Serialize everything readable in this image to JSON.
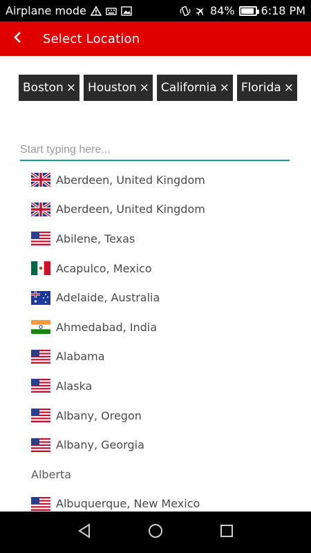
{
  "status_bar": {
    "left_text": "Airplane mode",
    "battery_percent": "84%",
    "battery_level": 0.84,
    "time": "6:18 PM",
    "icons": [
      "warning-icon",
      "keyboard-icon",
      "image-icon",
      "vibrate-icon",
      "airplane-icon",
      "battery-icon"
    ]
  },
  "app_bar": {
    "title": "Select Location",
    "background": "#e00000",
    "back_icon": "chevron-left-icon"
  },
  "chips": [
    {
      "label": "Boston"
    },
    {
      "label": "Houston"
    },
    {
      "label": "California"
    },
    {
      "label": "Florida"
    }
  ],
  "chip_remove_glyph": "×",
  "search": {
    "placeholder": "Start typing here...",
    "value": "",
    "underline_color": "#149e8c"
  },
  "suggestions": [
    {
      "label": "Aberdeen, United Kingdom",
      "flag": "uk-flag-icon"
    },
    {
      "label": "Aberdeen, United Kingdom",
      "flag": "uk-flag-icon"
    },
    {
      "label": "Abilene, Texas",
      "flag": "us-flag-icon"
    },
    {
      "label": "Acapulco, Mexico",
      "flag": "mexico-flag-icon"
    },
    {
      "label": "Adelaide, Australia",
      "flag": "australia-flag-icon"
    },
    {
      "label": "Ahmedabad, India",
      "flag": "india-flag-icon"
    },
    {
      "label": "Alabama",
      "flag": "us-flag-icon"
    },
    {
      "label": "Alaska",
      "flag": "us-flag-icon"
    },
    {
      "label": "Albany, Oregon",
      "flag": "us-flag-icon"
    },
    {
      "label": "Albany, Georgia",
      "flag": "us-flag-icon"
    },
    {
      "label": "Alberta",
      "flag": ""
    },
    {
      "label": "Albuquerque, New Mexico",
      "flag": "us-flag-icon"
    }
  ],
  "nav_bar": {
    "buttons": [
      "back-triangle-icon",
      "home-circle-icon",
      "recents-square-icon"
    ]
  }
}
